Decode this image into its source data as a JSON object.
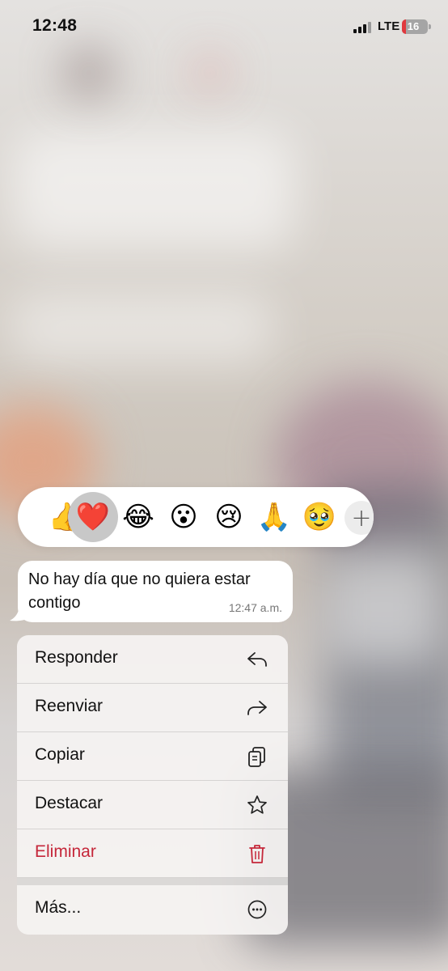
{
  "status_bar": {
    "time": "12:48",
    "network": "LTE",
    "battery": "16",
    "battery_level": 0.16
  },
  "reactions": {
    "items": [
      {
        "emoji": "👍",
        "name": "thumbs-up",
        "selected": false
      },
      {
        "emoji": "❤️",
        "name": "red-heart",
        "selected": true
      },
      {
        "emoji": "😂",
        "name": "tears-of-joy",
        "selected": false
      },
      {
        "emoji": "😮",
        "name": "surprised",
        "selected": false
      },
      {
        "emoji": "😢",
        "name": "crying",
        "selected": false
      },
      {
        "emoji": "🙏",
        "name": "folded-hands",
        "selected": false
      },
      {
        "emoji": "🥹",
        "name": "holding-back-tears",
        "selected": false
      }
    ],
    "more_label": "+"
  },
  "message": {
    "text": "No hay día que no quiera estar contigo",
    "time": "12:47 a.m."
  },
  "menu": {
    "items": [
      {
        "label": "Responder",
        "icon": "reply-icon"
      },
      {
        "label": "Reenviar",
        "icon": "forward-icon"
      },
      {
        "label": "Copiar",
        "icon": "copy-icon"
      },
      {
        "label": "Destacar",
        "icon": "star-icon"
      },
      {
        "label": "Eliminar",
        "icon": "trash-icon",
        "destructive": true
      },
      {
        "label": "Más...",
        "icon": "more-icon"
      }
    ],
    "destructive_color": "#c5273a"
  }
}
